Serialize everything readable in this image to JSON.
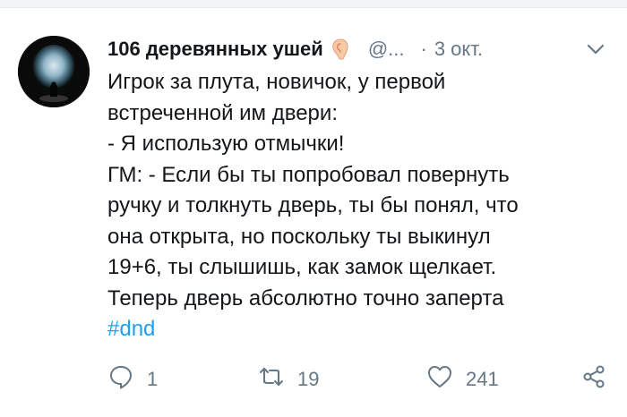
{
  "tweet": {
    "display_name": "106 деревянных ушей",
    "handle": "@...",
    "separator": "·",
    "time": "3 окт.",
    "lines": [
      "Игрок за плута, новичок, у первой",
      "встреченной им двери:",
      "- Я использую отмычки!",
      "ГМ: - Если бы ты попробовал повернуть",
      "ручку и толкнуть дверь, ты бы понял, что",
      "она открыта, но поскольку ты выкинул",
      "19+6, ты слышишь, как замок щелкает.",
      "Теперь дверь абсолютно точно заперта"
    ],
    "hashtag": "#dnd"
  },
  "actions": {
    "reply_count": "1",
    "retweet_count": "19",
    "like_count": "241"
  },
  "icons": {
    "name_badge": "ear-icon",
    "menu": "chevron-down-icon",
    "reply": "reply-icon",
    "retweet": "retweet-icon",
    "like": "heart-icon",
    "share": "share-icon"
  },
  "colors": {
    "text": "#14171a",
    "secondary": "#657786",
    "link": "#1da1f2"
  }
}
